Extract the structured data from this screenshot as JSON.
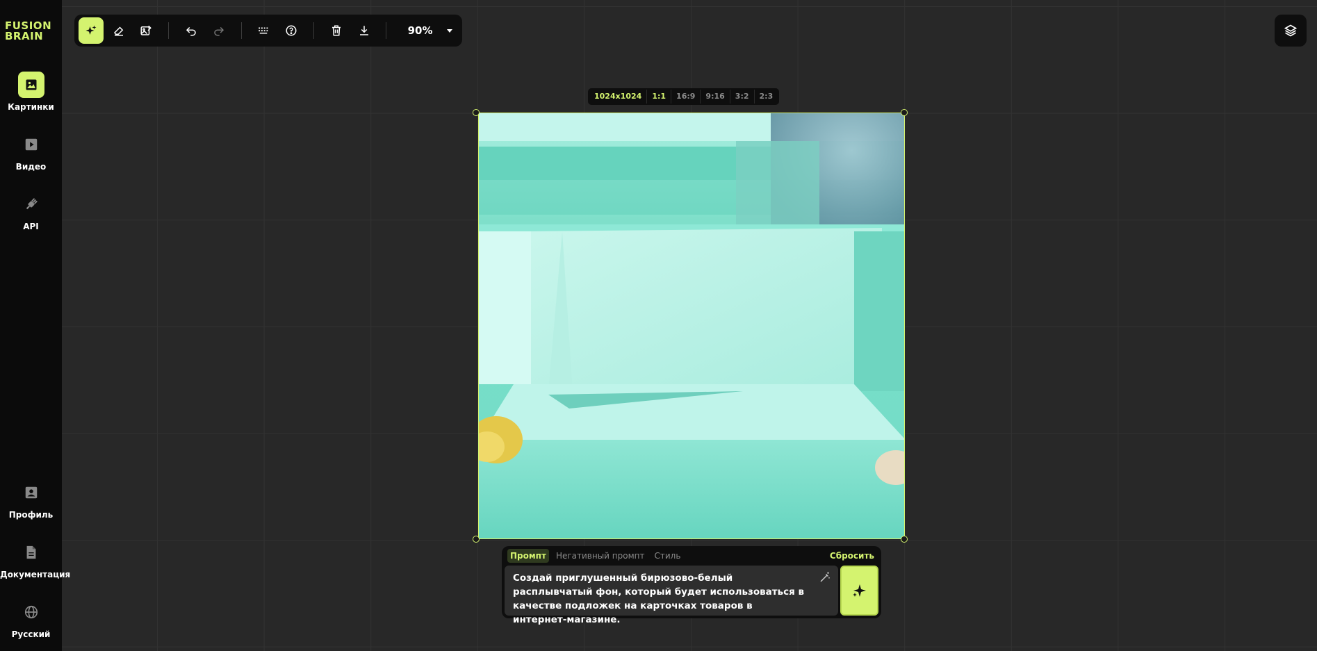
{
  "brand": {
    "line1": "FUSION",
    "line2": "BRAIN",
    "accent": "#d4f36f"
  },
  "sidebar": {
    "top_items": [
      {
        "label": "Картинки",
        "icon": "image-icon",
        "active": true
      },
      {
        "label": "Видео",
        "icon": "video-icon",
        "active": false
      },
      {
        "label": "API",
        "icon": "plug-icon",
        "active": false
      }
    ],
    "bottom_items": [
      {
        "label": "Профиль",
        "icon": "profile-icon"
      },
      {
        "label": "Документация",
        "icon": "document-icon"
      },
      {
        "label": "Русский",
        "icon": "globe-icon"
      }
    ]
  },
  "toolbar": {
    "tools": [
      "generate-icon",
      "eraser-icon",
      "image-edit-icon",
      "undo-icon",
      "redo-icon",
      "grid-icon",
      "help-icon",
      "trash-icon",
      "download-icon"
    ],
    "zoom": "90%"
  },
  "ratio": {
    "size": "1024x1024",
    "options": [
      "1:1",
      "16:9",
      "9:16",
      "3:2",
      "2:3"
    ],
    "selected": "1:1"
  },
  "prompt": {
    "tabs": [
      "Промпт",
      "Негативный промпт",
      "Стиль"
    ],
    "active_tab": "Промпт",
    "reset_label": "Сбросить",
    "text": "Создай приглушенный бирюзово-белый расплывчатый фон, который будет использоваться в качестве подложек на карточках товаров в интернет-магазине."
  }
}
